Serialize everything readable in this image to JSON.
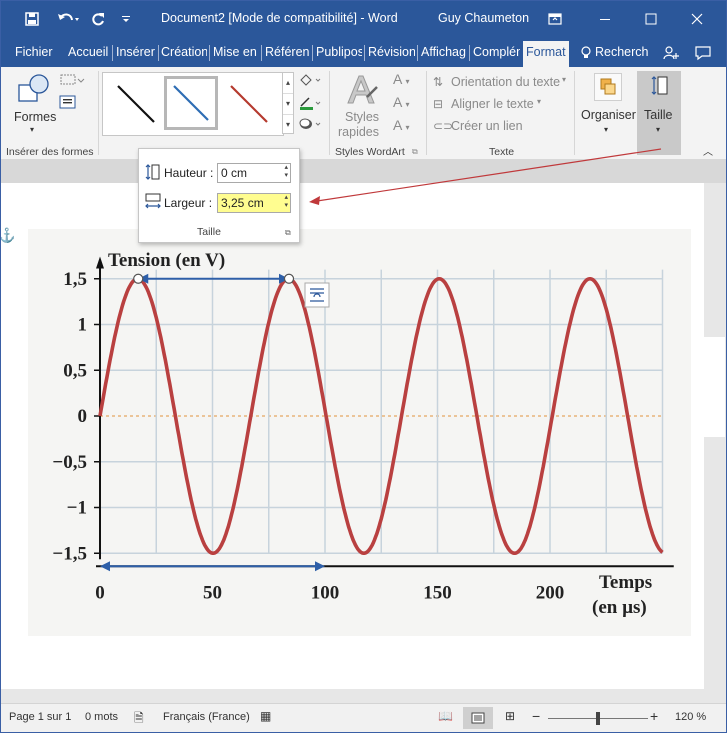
{
  "titlebar": {
    "doc_title": "Document2 [Mode de compatibilité]  -  Word",
    "user_name": "Guy Chaumeton",
    "qat": {
      "save_icon": "save-icon",
      "undo_icon": "undo-icon",
      "redo_icon": "redo-icon",
      "customize_icon": "customize-icon"
    }
  },
  "tabs": [
    {
      "label": "Fichier"
    },
    {
      "label": "Accueil"
    },
    {
      "label": "Insérer"
    },
    {
      "label": "Création"
    },
    {
      "label": "Mise en"
    },
    {
      "label": "Référenc"
    },
    {
      "label": "Publipos"
    },
    {
      "label": "Révision"
    },
    {
      "label": "Affichag"
    },
    {
      "label": "Complém"
    },
    {
      "label": "Format"
    }
  ],
  "search_label": "Recherch",
  "ribbon": {
    "shapes_label": "Formes",
    "insert_shapes_group": "Insérer des formes",
    "styles_label_1": "Styles",
    "styles_label_2": "rapides",
    "wordart_group": "Styles WordArt",
    "text_group": "Texte",
    "text_orientation": "Orientation du texte",
    "align_text": "Aligner le texte",
    "create_link": "Créer un lien",
    "organize": "Organiser",
    "size": "Taille"
  },
  "size_popup": {
    "height_label": "Hauteur :",
    "height_value": "0 cm",
    "width_label": "Largeur :",
    "width_value": "3,25 cm",
    "group_label": "Taille"
  },
  "chart_data": {
    "type": "line",
    "ylabel": "Tension (en V)",
    "xlabel_line1": "Temps",
    "xlabel_line2": "(en µs)",
    "x_ticks": [
      "0",
      "50",
      "100",
      "150",
      "200"
    ],
    "y_ticks": [
      "1,5",
      "1",
      "0,5",
      "0",
      "−0,5",
      "−1",
      "−1,5"
    ],
    "xlim": [
      0,
      250
    ],
    "ylim": [
      -1.5,
      1.5
    ],
    "series": [
      {
        "amplitude": 1.5,
        "period_us": 67,
        "color": "#b94040"
      }
    ],
    "measure_arrow_top": {
      "from_x": 17,
      "to_x": 84,
      "y": 1.5
    },
    "measure_arrow_bottom": {
      "from_x": 0,
      "to_x": 100,
      "y": -1.5
    },
    "grid": true
  },
  "statusbar": {
    "page": "Page 1 sur 1",
    "words": "0 mots",
    "language": "Français (France)",
    "zoom": "120 %"
  },
  "colors": {
    "accent": "#2b579a",
    "curve": "#b94040",
    "arrow": "#2e5fa8",
    "highlight": "#fffd90"
  }
}
